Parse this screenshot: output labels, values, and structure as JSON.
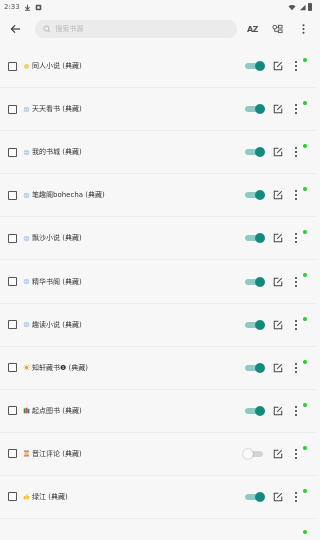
{
  "status_bar": {
    "time": "2:33"
  },
  "search": {
    "placeholder": "搜索书源"
  },
  "toolbar": {
    "sort_label": "AZ"
  },
  "colors": {
    "accent": "#138a7d",
    "active_dot": "#2ed12e"
  },
  "sources": [
    {
      "name": "同人小说 (典藏)",
      "icon": "sun-small-icon",
      "enabled": true,
      "active": true
    },
    {
      "name": "天天看书 (典藏)",
      "icon": "globe-icon",
      "enabled": true,
      "active": true
    },
    {
      "name": "我的书城 (典藏)",
      "icon": "globe-icon",
      "enabled": true,
      "active": true
    },
    {
      "name": "笔趣阁bohecha (典藏)",
      "icon": "globe-icon",
      "enabled": true,
      "active": true
    },
    {
      "name": "飘沙小说 (典藏)",
      "icon": "globe-icon",
      "enabled": true,
      "active": true
    },
    {
      "name": "精华书阁 (典藏)",
      "icon": "globe-icon",
      "enabled": true,
      "active": true
    },
    {
      "name": "趣读小说 (典藏)",
      "icon": "globe-icon",
      "enabled": true,
      "active": true
    },
    {
      "name": "知轩藏书❶ (典藏)",
      "icon": "sun-icon",
      "enabled": true,
      "active": true
    },
    {
      "name": "起点图书 (典藏)",
      "icon": "books-icon",
      "enabled": true,
      "active": true
    },
    {
      "name": "晋江评论 (典藏)",
      "icon": "scroll-icon",
      "enabled": false,
      "active": true
    },
    {
      "name": "绿江 (典藏)",
      "icon": "thumbs-up-icon",
      "enabled": true,
      "active": true
    }
  ]
}
